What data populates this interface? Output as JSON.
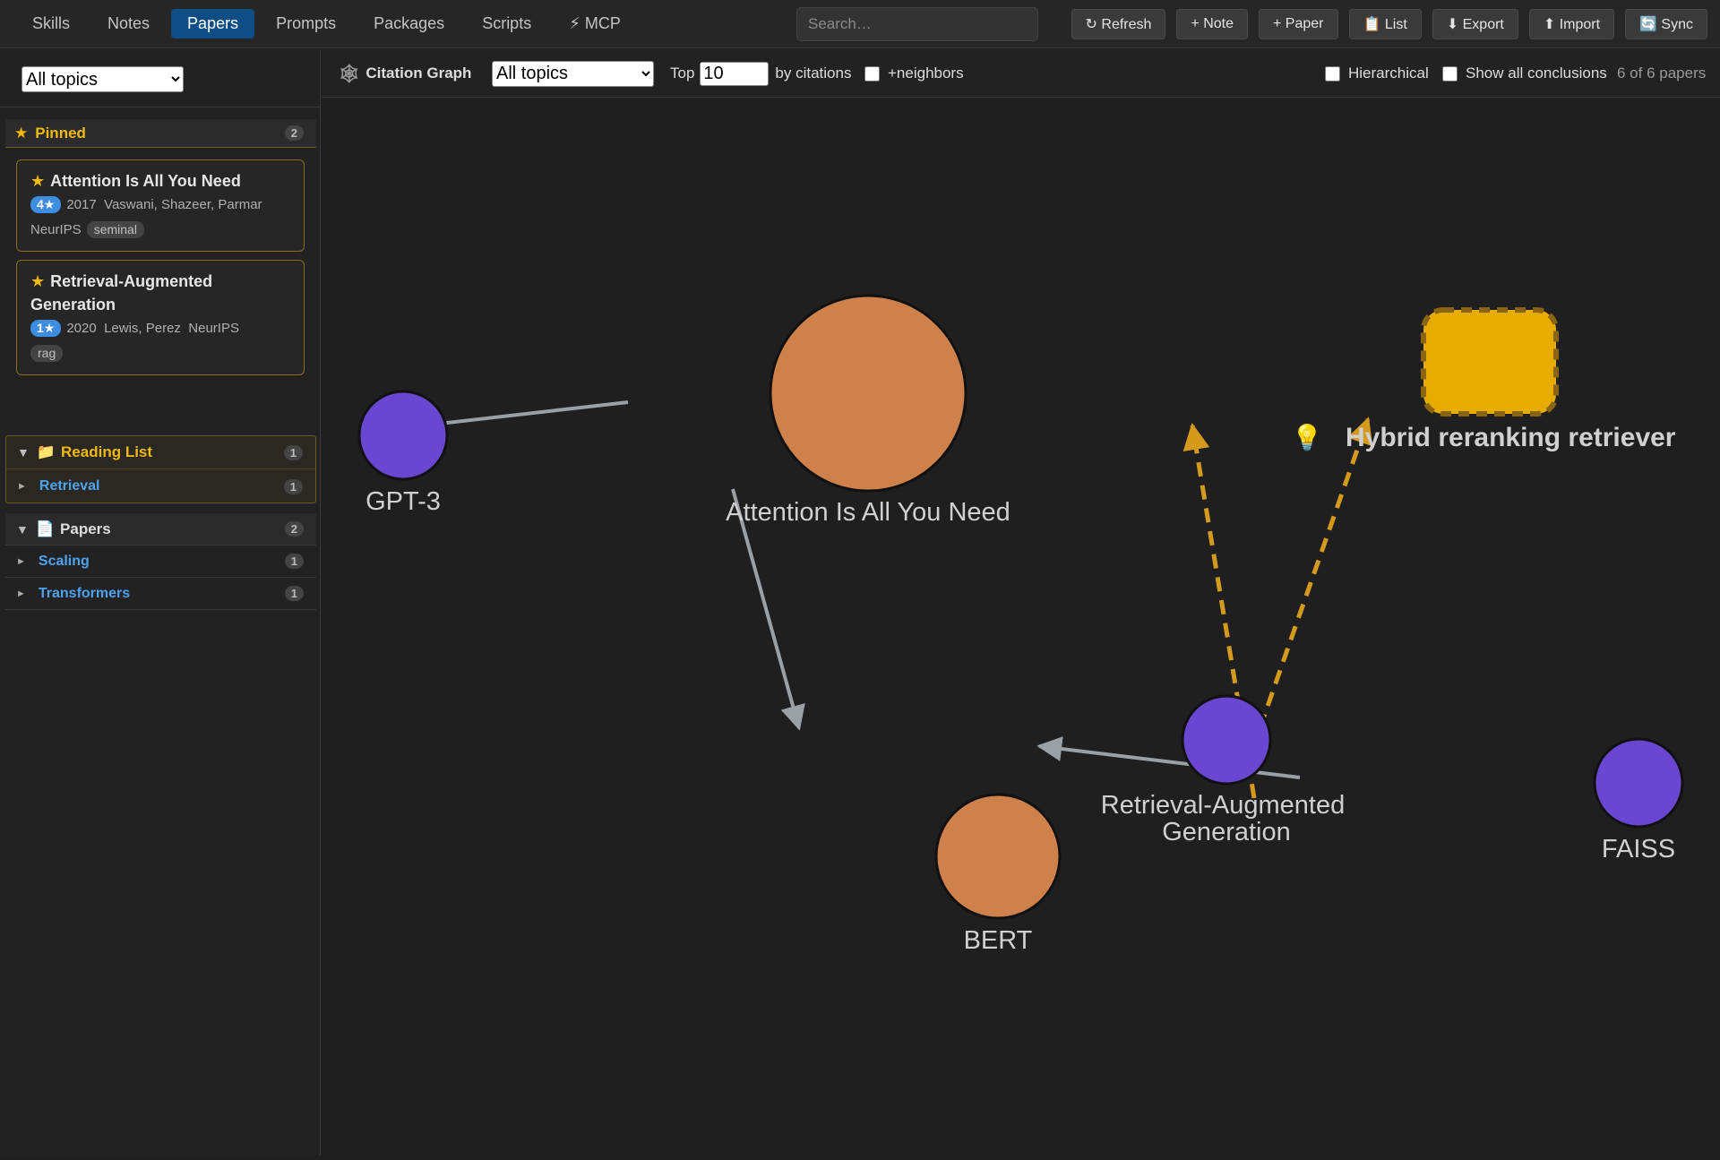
{
  "nav": {
    "tabs": [
      {
        "label": "Skills"
      },
      {
        "label": "Notes"
      },
      {
        "label": "Papers"
      },
      {
        "label": "Prompts"
      },
      {
        "label": "Packages"
      },
      {
        "label": "Scripts"
      },
      {
        "label": "⚡ MCP"
      }
    ],
    "active_tab": "Papers",
    "search_placeholder": "Search…",
    "buttons": {
      "refresh": "↻ Refresh",
      "note": "+ Note",
      "paper": "+ Paper",
      "list": "📋 List",
      "export": "⬇ Export",
      "import": "⬆ Import",
      "sync": "🔄 Sync"
    }
  },
  "sidebar": {
    "topic_filter": "All topics",
    "pinned": {
      "label": "Pinned",
      "icon": "star-icon",
      "count": "2",
      "cards": [
        {
          "title": "Attention Is All You Need",
          "rating": "4★",
          "year": "2017",
          "authors": "Vaswani, Shazeer, Parmar",
          "venue": "NeurIPS",
          "tag": "seminal"
        },
        {
          "title": "Retrieval-Augmented Generation",
          "rating": "1★",
          "year": "2020",
          "authors": "Lewis, Perez",
          "venue": "NeurIPS",
          "tag": "rag"
        }
      ]
    },
    "reading_list": {
      "label": "Reading List",
      "icon": "folder-icon",
      "count": "1",
      "items": [
        {
          "label": "Retrieval",
          "count": "1"
        }
      ]
    },
    "papers": {
      "label": "Papers",
      "icon": "document-icon",
      "count": "2",
      "items": [
        {
          "label": "Scaling",
          "count": "1"
        },
        {
          "label": "Transformers",
          "count": "1"
        }
      ]
    }
  },
  "graph_toolbar": {
    "title": "Citation Graph",
    "icon": "web-icon",
    "topic_filter": "All topics",
    "top_label": "Top",
    "top_value": "10",
    "by_label": "by citations",
    "neighbors_label": "+neighbors",
    "hierarchical_label": "Hierarchical",
    "show_conclusions_label": "Show all conclusions",
    "paper_count": "6 of 6 papers"
  },
  "graph": {
    "nodes": [
      {
        "label": "Attention Is All You Need",
        "kind": "paper-seminal",
        "color": "#cf814b"
      },
      {
        "label": "GPT-3",
        "kind": "paper",
        "color": "#6a47d1"
      },
      {
        "label": "BERT",
        "kind": "paper-seminal",
        "color": "#cf814b"
      },
      {
        "label": "Retrieval-Augmented",
        "label2": "Generation",
        "kind": "paper",
        "color": "#6a47d1"
      },
      {
        "label": "FAISS",
        "kind": "paper",
        "color": "#6a47d1"
      },
      {
        "label": "Hybrid reranking retriever",
        "kind": "conclusion",
        "icon": "lightbulb-icon",
        "color": "#e8ac00"
      }
    ],
    "edges": [
      {
        "from": "Attention Is All You Need",
        "to": "GPT-3",
        "style": "cites"
      },
      {
        "from": "Attention Is All You Need",
        "to": "BERT",
        "style": "cites"
      },
      {
        "from": "FAISS",
        "to": "Retrieval-Augmented Generation",
        "style": "cites"
      },
      {
        "from": "Retrieval-Augmented Generation",
        "to": "Hybrid reranking retriever",
        "style": "supports"
      },
      {
        "from": "FAISS",
        "to": "Hybrid reranking retriever",
        "style": "supports"
      }
    ],
    "colors": {
      "cites_edge": "#9aa0a6",
      "supports_edge": "#d49a1c",
      "text": "#d0d0d0"
    }
  }
}
